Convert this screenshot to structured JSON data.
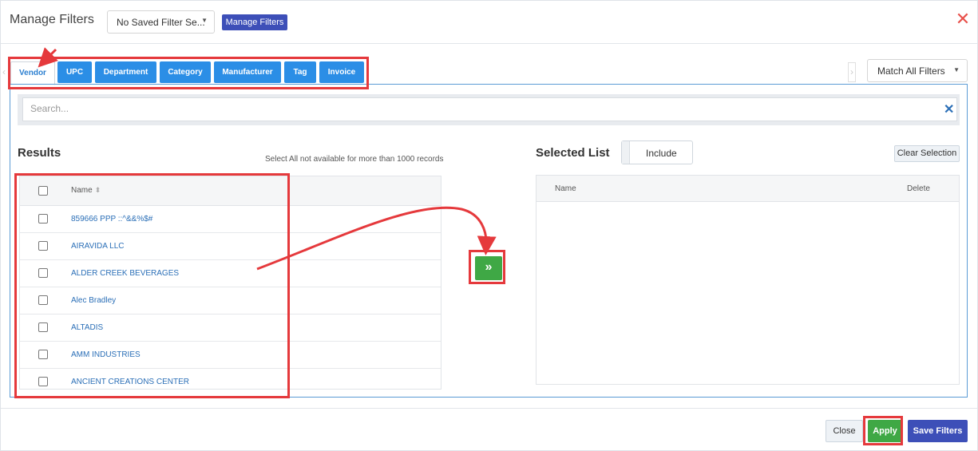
{
  "dialog": {
    "title": "Manage Filters",
    "saved_filter_select": "No Saved Filter Se...",
    "manage_filters_button": "Manage Filters",
    "close_icon": "close-icon"
  },
  "tabs": [
    {
      "label": "Vendor",
      "active": true
    },
    {
      "label": "UPC",
      "active": false
    },
    {
      "label": "Department",
      "active": false
    },
    {
      "label": "Category",
      "active": false
    },
    {
      "label": "Manufacturer",
      "active": false
    },
    {
      "label": "Tag",
      "active": false
    },
    {
      "label": "Invoice",
      "active": false
    }
  ],
  "match_select": "Match All Filters",
  "search": {
    "placeholder": "Search..."
  },
  "results": {
    "heading": "Results",
    "note": "Select All not available for more than 1000 records",
    "column_name": "Name",
    "rows": [
      "859666 PPP ::^&&%$#",
      "AIRAVIDA LLC",
      "ALDER CREEK BEVERAGES",
      "Alec Bradley",
      "ALTADIS",
      "AMM INDUSTRIES",
      "ANCIENT CREATIONS CENTER"
    ]
  },
  "move_button": "»",
  "selected": {
    "heading": "Selected List",
    "include_label": "Include",
    "clear_button": "Clear Selection",
    "column_name": "Name",
    "column_delete": "Delete"
  },
  "footer": {
    "close": "Close",
    "apply": "Apply",
    "save": "Save Filters"
  },
  "colors": {
    "tab_blue": "#2b8ee6",
    "primary": "#3d4fb8",
    "apply_green": "#3fa845",
    "annotation_red": "#e5393c"
  }
}
